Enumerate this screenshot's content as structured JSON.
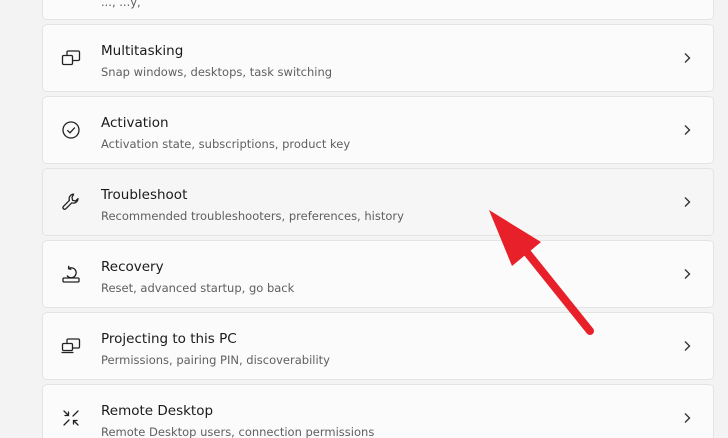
{
  "top_partial": {
    "subtitle": "..., ...y,"
  },
  "items": [
    {
      "title": "Multitasking",
      "subtitle": "Snap windows, desktops, task switching",
      "icon": "multitasking-icon"
    },
    {
      "title": "Activation",
      "subtitle": "Activation state, subscriptions, product key",
      "icon": "activation-icon"
    },
    {
      "title": "Troubleshoot",
      "subtitle": "Recommended troubleshooters, preferences, history",
      "icon": "wrench-icon"
    },
    {
      "title": "Recovery",
      "subtitle": "Reset, advanced startup, go back",
      "icon": "recovery-icon"
    },
    {
      "title": "Projecting to this PC",
      "subtitle": "Permissions, pairing PIN, discoverability",
      "icon": "projecting-icon"
    },
    {
      "title": "Remote Desktop",
      "subtitle": "Remote Desktop users, connection permissions",
      "icon": "remote-desktop-icon"
    }
  ],
  "colors": {
    "background": "#f3f3f3",
    "card": "#fbfbfb",
    "annotation_arrow": "#e8202a"
  }
}
